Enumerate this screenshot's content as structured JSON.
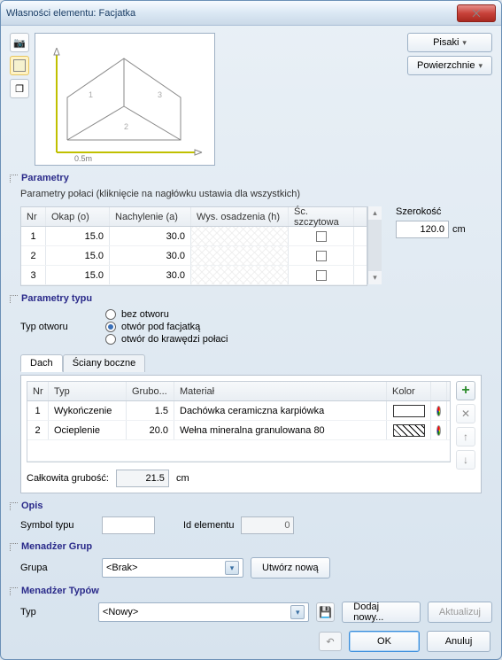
{
  "window": {
    "title": "Własności elementu: Facjatka"
  },
  "buttons": {
    "pens": "Pisaki",
    "surfaces": "Powierzchnie",
    "new_group": "Utwórz nową",
    "add_new": "Dodaj nowy...",
    "update": "Aktualizuj",
    "ok": "OK",
    "cancel": "Anuluj"
  },
  "preview": {
    "axis_label": "0.5m",
    "face_labels": [
      "1",
      "2",
      "3"
    ]
  },
  "sections": {
    "params": "Parametry",
    "params_type": "Parametry typu",
    "desc": "Opis",
    "group_mgr": "Menadżer Grup",
    "type_mgr": "Menadżer Typów"
  },
  "params": {
    "hint": "Parametry połaci (kliknięcie na nagłówku ustawia dla wszystkich)",
    "headers": {
      "nr": "Nr",
      "okap": "Okap (o)",
      "nach": "Nachylenie (a)",
      "wys": "Wys. osadzenia (h)",
      "sc": "Śc. szczytowa"
    },
    "rows": [
      {
        "nr": "1",
        "okap": "15.0",
        "nach": "30.0"
      },
      {
        "nr": "2",
        "okap": "15.0",
        "nach": "30.0"
      },
      {
        "nr": "3",
        "okap": "15.0",
        "nach": "30.0"
      }
    ],
    "width_label": "Szerokość",
    "width_value": "120.0",
    "width_unit": "cm"
  },
  "type_params": {
    "label": "Typ otworu",
    "options": {
      "none": "bez otworu",
      "under": "otwór pod facjatką",
      "edge": "otwór do krawędzi połaci"
    },
    "selected": "under"
  },
  "tabs": {
    "roof": "Dach",
    "walls": "Ściany boczne",
    "active": "roof"
  },
  "materials": {
    "headers": {
      "nr": "Nr",
      "typ": "Typ",
      "gru": "Grubo...",
      "mat": "Materiał",
      "kol": "Kolor"
    },
    "rows": [
      {
        "nr": "1",
        "typ": "Wykończenie",
        "gru": "1.5",
        "mat": "Dachówka ceramiczna karpiówka",
        "hatch": "plain"
      },
      {
        "nr": "2",
        "typ": "Ocieplenie",
        "gru": "20.0",
        "mat": "Wełna mineralna granulowana 80",
        "hatch": "hatch"
      }
    ],
    "total_label": "Całkowita grubość:",
    "total_value": "21.5",
    "total_unit": "cm"
  },
  "desc": {
    "symbol_label": "Symbol typu",
    "symbol_value": "",
    "id_label": "Id elementu",
    "id_value": "0"
  },
  "group": {
    "label": "Grupa",
    "value": "<Brak>"
  },
  "type": {
    "label": "Typ",
    "value": "<Nowy>"
  }
}
